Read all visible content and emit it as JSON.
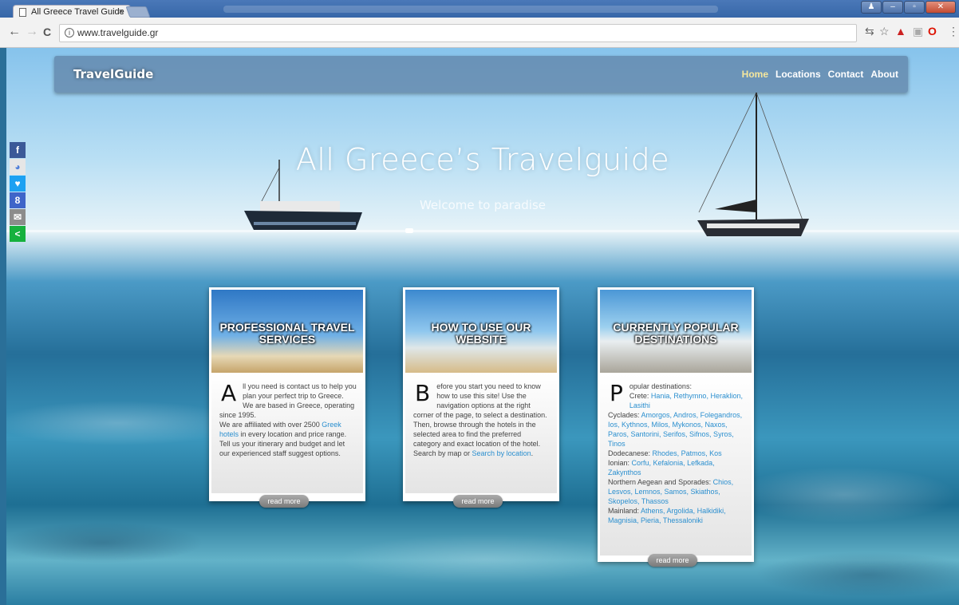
{
  "browser": {
    "tab_title": "All Greece Travel Guide",
    "tab_close": "×",
    "url": "www.travelguide.gr",
    "back": "←",
    "forward": "→",
    "reload": "C",
    "info": "i"
  },
  "site": {
    "logo": "TravelGuide",
    "nav": [
      "Home",
      "Locations",
      "Contact",
      "About"
    ],
    "hero_title": "All Greece’s Travelguide",
    "hero_subtitle": "Welcome to paradise"
  },
  "social": [
    {
      "name": "facebook",
      "glyph": "f",
      "color": "#3b5998"
    },
    {
      "name": "google-talk",
      "glyph": "◕",
      "color": "#4f7fd9"
    },
    {
      "name": "twitter",
      "glyph": "♥",
      "color": "#1da1f2"
    },
    {
      "name": "google-plus",
      "glyph": "8",
      "color": "#3f65c9"
    },
    {
      "name": "email",
      "glyph": "✉",
      "color": "#8c8c8c"
    },
    {
      "name": "share",
      "glyph": "<",
      "color": "#16b13e"
    }
  ],
  "cards": [
    {
      "title": "PROFESSIONAL TRAVEL SERVICES",
      "drop": "A",
      "text_1": "ll you need is contact us to help you plan your perfect trip to Greece.",
      "text_2": "We are based in Greece, operating since 1995.",
      "text_3a": "We are affiliated with over 2500 ",
      "link_1": "Greek hotels",
      "text_3b": " in every location and price range. Tell us your itinerary and budget and let our experienced staff suggest options.",
      "read_more": "read more"
    },
    {
      "title": "HOW TO USE OUR WEBSITE",
      "drop": "B",
      "text_1": "efore you start you need to know how to use this site! Use the navigation options at the right corner of the page, to select a destination. Then, browse through the hotels in the selected area to find the preferred category and exact location of the hotel. Search by map or ",
      "link_1": "Search by location",
      "text_2": ".",
      "read_more": "read more"
    },
    {
      "title": "CURRENTLY POPULAR DESTINATIONS",
      "drop": "P",
      "intro": "opular destinations:",
      "groups": [
        {
          "label": "Crete: ",
          "items": "Hania, Rethymno, Heraklion, Lasithi"
        },
        {
          "label": "Cyclades: ",
          "items": "Amorgos, Andros, Folegandros, Ios, Kythnos, Milos, Mykonos, Naxos, Paros, Santorini, Serifos, Sifnos, Syros, Tinos"
        },
        {
          "label": "Dodecanese: ",
          "items": "Rhodes, Patmos, Kos"
        },
        {
          "label": "Ionian: ",
          "items": "Corfu, Kefalonia, Lefkada, Zakynthos"
        },
        {
          "label": "Northern Aegean and Sporades: ",
          "items": "Chios, Lesvos, Lemnos, Samos, Skiathos, Skopelos, Thassos"
        },
        {
          "label": "Mainland: ",
          "items": "Athens, Argolida, Halkidiki, Magnisia, Pieria, Thessaloniki"
        }
      ],
      "read_more": "read more"
    }
  ]
}
